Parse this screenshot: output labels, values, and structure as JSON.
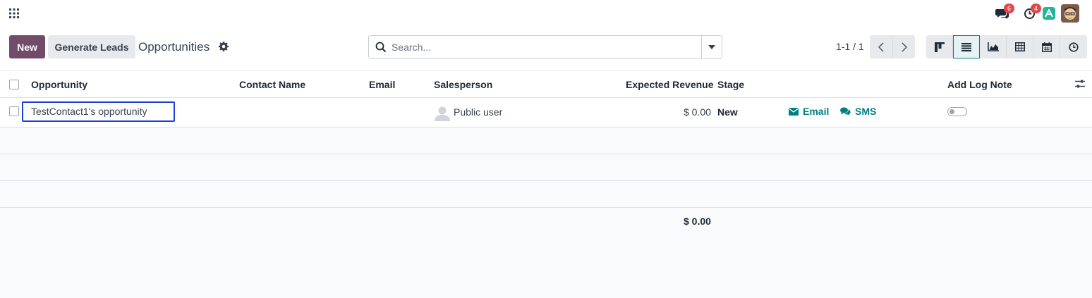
{
  "navbar": {
    "messages_badge": "6",
    "activities_badge": "4"
  },
  "control_panel": {
    "new_label": "New",
    "generate_leads_label": "Generate Leads",
    "title": "Opportunities",
    "search_placeholder": "Search...",
    "pager": "1-1 / 1"
  },
  "list": {
    "columns": {
      "opportunity": "Opportunity",
      "contact_name": "Contact Name",
      "email": "Email",
      "salesperson": "Salesperson",
      "expected_revenue": "Expected Revenue",
      "stage": "Stage",
      "add_log_note": "Add Log Note"
    },
    "rows": [
      {
        "opportunity": "TestContact1's opportunity",
        "contact_name": "",
        "email": "",
        "salesperson": "Public user",
        "expected_revenue": "$ 0.00",
        "stage": "New",
        "email_action": "Email",
        "sms_action": "SMS",
        "log_note": false
      }
    ],
    "total_revenue": "$ 0.00"
  },
  "colors": {
    "brand": "#714b67",
    "accent": "#017e84",
    "highlight": "#1f3fe0",
    "badge": "#e0464d"
  }
}
